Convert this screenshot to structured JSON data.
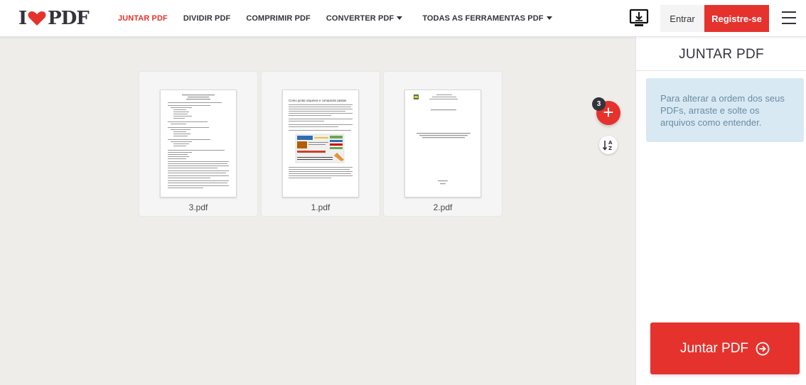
{
  "header": {
    "logo": {
      "left": "I",
      "right": "PDF"
    },
    "nav": [
      {
        "label": "JUNTAR PDF",
        "active": true
      },
      {
        "label": "DIVIDIR PDF",
        "active": false
      },
      {
        "label": "COMPRIMIR PDF",
        "active": false
      },
      {
        "label": "CONVERTER PDF",
        "active": false,
        "dropdown": true
      },
      {
        "label": "TODAS AS FERRAMENTAS PDF",
        "active": false,
        "dropdown": true
      }
    ],
    "desktop_icon": "desktop-download-icon",
    "login_label": "Entrar",
    "signup_label": "Registre-se",
    "menu_icon": "hamburger-menu-icon"
  },
  "workspace": {
    "file_count": "3",
    "add_icon": "plus-icon",
    "sort_icon": "sort-az-icon",
    "files": [
      {
        "name": "3.pdf",
        "type": "list-document"
      },
      {
        "name": "1.pdf",
        "type": "article"
      },
      {
        "name": "2.pdf",
        "type": "cover-page"
      }
    ],
    "thumb_heading": "Como juntar arquivos e compactar pastas"
  },
  "sidebar": {
    "title": "JUNTAR PDF",
    "info": "Para alterar a ordem dos seus PDFs, arraste e solte os arquivos como entender.",
    "merge_label": "Juntar PDF"
  },
  "colors": {
    "brand_red": "#e5322d",
    "dark": "#33333b",
    "workspace_bg": "#efedea",
    "info_bg": "#d8e9f3"
  }
}
